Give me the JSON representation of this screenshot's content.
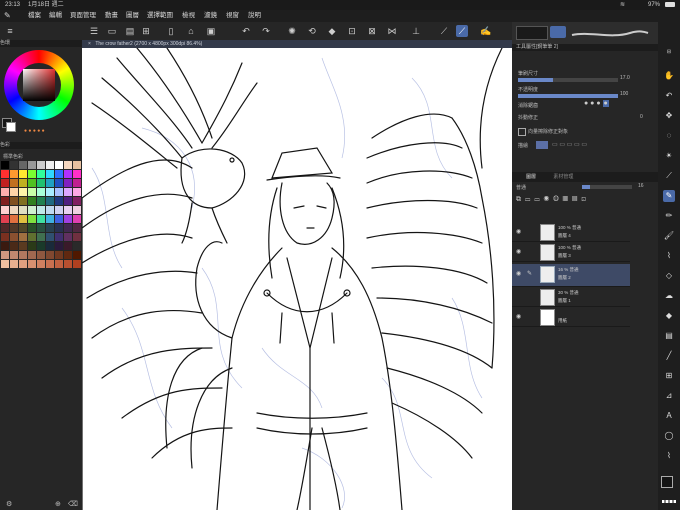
{
  "status": {
    "time": "23:13",
    "date": "1月18日 週二",
    "battery": "97%"
  },
  "menu": {
    "items": [
      "檔案",
      "編輯",
      "頁面管理",
      "動畫",
      "圖層",
      "選擇範圍",
      "檢視",
      "濾鏡",
      "視窗",
      "說明"
    ]
  },
  "left": {
    "color_wheel_title": "色環",
    "color_set_title": "色彩",
    "color_set_name": "標準色彩"
  },
  "canvas": {
    "tab_title": "The crow father2 (2700 x 4800px 300dpi 86.4%)"
  },
  "tool_property": {
    "title": "工具屬性[鋼筆筆 2]",
    "brush_size_label": "筆刷尺寸",
    "brush_size_value": "17.0",
    "opacity_label": "不透明度",
    "opacity_value": "100",
    "anti_alias_label": "消除鋸齒",
    "stabilization_label": "抖動修正",
    "stabilization_value": "0",
    "vector_label": "向量擦除修正對象",
    "angle_label": "描繪"
  },
  "layers": {
    "tab_label": "圖層",
    "tab2_label": "素材管理",
    "blend_mode": "普通",
    "opacity": "16",
    "items": [
      {
        "mode": "100 % 普通",
        "name": "圖層 4"
      },
      {
        "mode": "100 % 普通",
        "name": "圖層 3"
      },
      {
        "mode": "16 % 普通",
        "name": "圖層 2",
        "selected": true
      },
      {
        "mode": "30 % 普通",
        "name": "圖層 1"
      },
      {
        "mode": "",
        "name": "用紙"
      }
    ]
  },
  "colors": {
    "accent": "#4a6aa8",
    "ink": "#141414",
    "sketch": "#9aa6d8"
  }
}
